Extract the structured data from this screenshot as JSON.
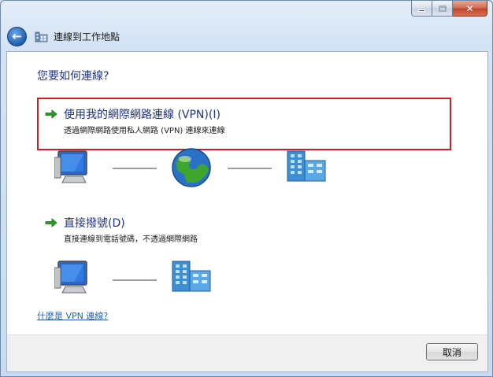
{
  "window": {
    "title": "連線到工作地點",
    "close_glyph": "✕",
    "accent_close": "#c4472c"
  },
  "header": {
    "back_icon": "back-arrow-icon",
    "back_glyph": "←",
    "title_icon": "workplace-icon"
  },
  "main": {
    "question": "您要如何連線?",
    "options": [
      {
        "title": "使用我的網際網路連線 (VPN)(I)",
        "description": "透過網際網路使用私人網路 (VPN) 連線來連線",
        "icon": "green-arrow-icon",
        "highlighted": true,
        "diagram": [
          "computer-icon",
          "globe-icon",
          "office-building-icon"
        ]
      },
      {
        "title": "直接撥號(D)",
        "description": "直接連線到電話號碼，不透過網際網路",
        "icon": "green-arrow-icon",
        "highlighted": false,
        "diagram": [
          "computer-icon",
          "office-building-icon"
        ]
      }
    ],
    "help_link": "什麼是 VPN 連線?"
  },
  "footer": {
    "cancel_label": "取消"
  },
  "colors": {
    "heading": "#1e3287",
    "highlight_border": "#d91a1a",
    "link": "#1e63b8"
  }
}
